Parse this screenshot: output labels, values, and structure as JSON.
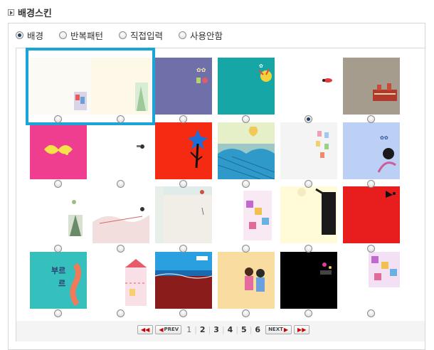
{
  "title": "배경스킨",
  "mode_options": [
    {
      "label": "배경",
      "selected": true
    },
    {
      "label": "반복패턴",
      "selected": false
    },
    {
      "label": "직접입력",
      "selected": false
    },
    {
      "label": "사용안함",
      "selected": false
    }
  ],
  "colors": {
    "selection_border": "#1aa5d8",
    "panel_border": "#d8d8d8"
  },
  "selected_skin": "row1-col5",
  "pagination": {
    "first_label": "◀◀",
    "prev_label": "PREV",
    "pages": [
      "1",
      "2",
      "3",
      "4",
      "5",
      "6"
    ],
    "current": "1",
    "next_label": "NEXT",
    "last_label": "▶▶"
  }
}
